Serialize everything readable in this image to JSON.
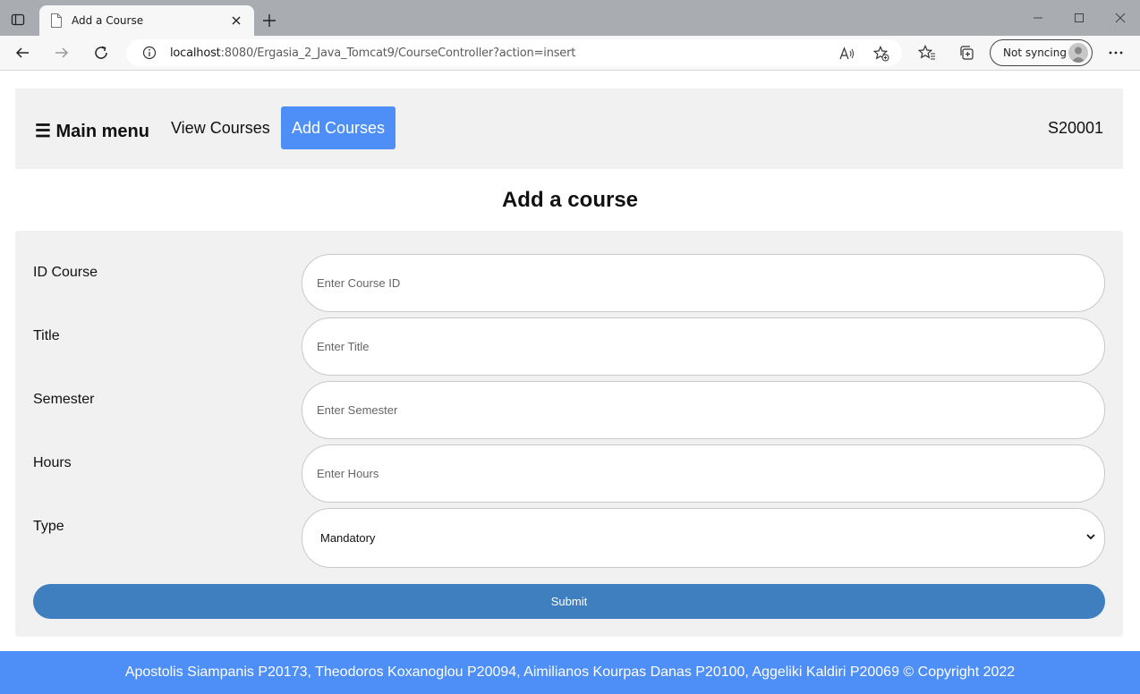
{
  "browser": {
    "tab_title": "Add a Course",
    "url_host": "localhost",
    "url_rest": ":8080/Ergasia_2_Java_Tomcat9/CourseController?action=insert",
    "sync_label": "Not syncing"
  },
  "navbar": {
    "brand": "☰ Main menu",
    "links": [
      {
        "label": "View Courses",
        "active": false
      },
      {
        "label": "Add Courses",
        "active": true
      }
    ],
    "user": "S20001"
  },
  "page_title": "Add a course",
  "form": {
    "fields": [
      {
        "label": "ID Course",
        "placeholder": "Enter Course ID"
      },
      {
        "label": "Title",
        "placeholder": "Enter Title"
      },
      {
        "label": "Semester",
        "placeholder": "Enter Semester"
      },
      {
        "label": "Hours",
        "placeholder": "Enter Hours"
      }
    ],
    "type": {
      "label": "Type",
      "selected": "Mandatory"
    },
    "submit_label": "Submit"
  },
  "footer": {
    "text": "Apostolis Siampanis P20173, Theodoros Koxanoglou P20094, Aimilianos Kourpas Danas P20100, Aggeliki Kaldiri P20069 © Copyright 2022"
  },
  "colors": {
    "accent": "#4e8ef7",
    "submit": "#3f7fbf",
    "panel": "#f1f1f1"
  }
}
